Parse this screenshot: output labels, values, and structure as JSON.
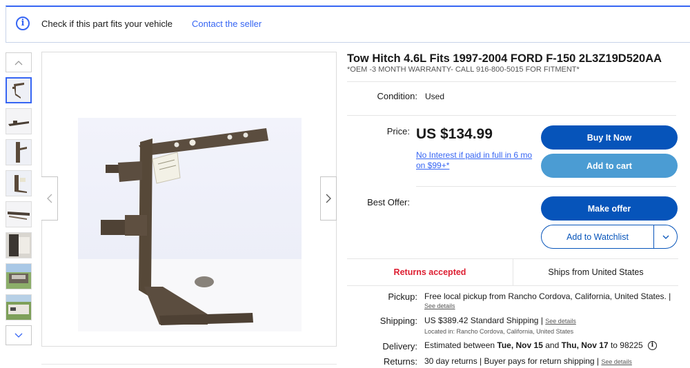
{
  "fitment_bar": {
    "icon": "info-icon",
    "text": "Check if this part fits your vehicle",
    "contact_link": "Contact the seller"
  },
  "gallery": {
    "thumbnails": [
      "thumbnail-1",
      "thumbnail-2",
      "thumbnail-3",
      "thumbnail-4",
      "thumbnail-5",
      "thumbnail-6",
      "thumbnail-7",
      "thumbnail-8"
    ],
    "active_index": 0
  },
  "listing": {
    "title": "Tow Hitch 4.6L Fits 1997-2004 FORD F-150 2L3Z19D520AA",
    "subtitle": "*OEM -3 MONTH WARRANTY- CALL 916-800-5015 FOR FITMENT*"
  },
  "condition": {
    "label": "Condition:",
    "value": "Used"
  },
  "price": {
    "label": "Price:",
    "value": "US $134.99",
    "finance_text": "No Interest if paid in full in 6 mo on $99+*"
  },
  "buttons": {
    "buy_now": "Buy It Now",
    "add_to_cart": "Add to cart",
    "make_offer": "Make offer",
    "add_to_watchlist": "Add to Watchlist"
  },
  "best_offer": {
    "label": "Best Offer:"
  },
  "badges": {
    "returns": "Returns accepted",
    "ships_from": "Ships from United States"
  },
  "pickup": {
    "label": "Pickup:",
    "value": "Free local pickup from Rancho Cordova, California, United States. |",
    "details_link": "See details"
  },
  "shipping": {
    "label": "Shipping:",
    "amount": "US $389.42",
    "method": "Standard Shipping",
    "separator": "|",
    "details_link": "See details",
    "location": "Located in: Rancho Cordova, California, United States"
  },
  "delivery": {
    "label": "Delivery:",
    "prefix": "Estimated between",
    "start": "Tue, Nov 15",
    "and": "and",
    "end": "Thu, Nov 17",
    "to": "to 98225"
  },
  "returns": {
    "label": "Returns:",
    "value": "30 day returns | Buyer pays for return shipping |",
    "details_link": "See details"
  },
  "colors": {
    "primary_button": "#0654ba",
    "secondary_button": "#4b9cd3",
    "link": "#3665f3",
    "returns_red": "#dd1e31"
  }
}
